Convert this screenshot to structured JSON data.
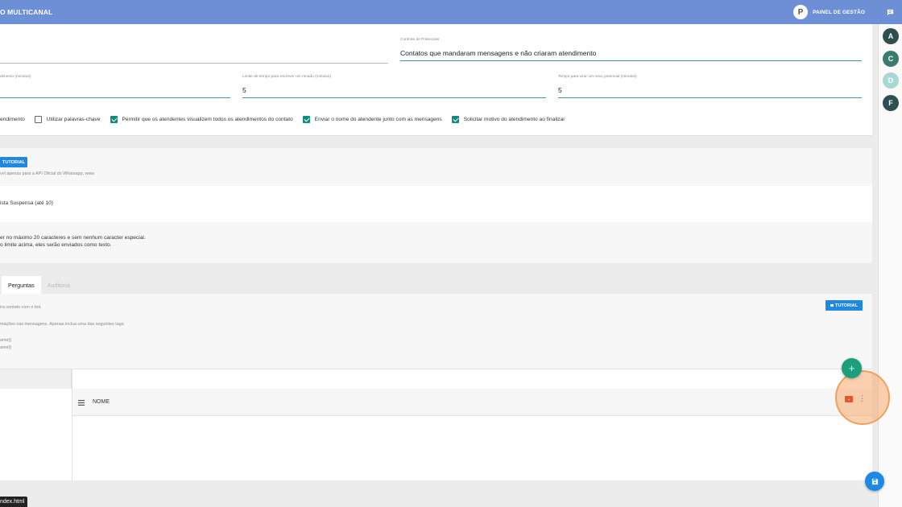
{
  "header": {
    "title": "O MULTICANAL",
    "user_initial": "P",
    "panel_label": "PAINEL DE GESTÃO"
  },
  "rail": {
    "avatars": [
      {
        "initial": "A",
        "color": "#2f4f4f"
      },
      {
        "initial": "C",
        "color": "#3b7a6e"
      },
      {
        "initial": "D",
        "color": "#a8d8d4"
      },
      {
        "initial": "F",
        "color": "#2f4f4f"
      }
    ]
  },
  "settings": {
    "control_label": "Controle de Potenciais",
    "control_value": "Contatos que mandaram mensagens e não criaram atendimento",
    "time_label_1": "dimento (minutos)",
    "time_label_2": "Limite de tempo para escrever um recado (minutos)",
    "time_value_2": "5",
    "time_label_3": "Tempo para virar um novo potencial (minutos)",
    "time_value_3": "5",
    "checks": [
      {
        "label": "endimento",
        "checked": null
      },
      {
        "label": "Utilizar palavras-chave",
        "checked": false
      },
      {
        "label": "Permitir que os atendentes visualizem todos os atendimentos do contato",
        "checked": true
      },
      {
        "label": "Enviar o nome do atendente junto com as mensagens",
        "checked": true
      },
      {
        "label": "Solicitar motivo do atendimento ao finalizar",
        "checked": true
      }
    ]
  },
  "whatsapp": {
    "tutorial_label": "TUTORIAL",
    "note": "vel apenas para a API Oficial do Whatsapp, www",
    "list_label": "ista Suspensa (até 10)",
    "rule_line1": "er no máximo 20 caracteres e sem nenhum caracter especial.",
    "rule_line2": "o limite acima, eles serão enviados como texto."
  },
  "tabs": {
    "active": "Perguntas",
    "inactive": "Auditoria"
  },
  "bot": {
    "line1": "ira contato com o bot.",
    "line2": "mações nas mensagens. Apenas inclua uma das seguintes tags:",
    "tag1": "ame}}",
    "tag2": "ame}}",
    "tutorial_label": "TUTORIAL",
    "column_name": "NOME"
  },
  "status_bar": {
    "text": "ndex.html"
  },
  "colors": {
    "topbar": "#6d8fd6",
    "accent_teal": "#0e8c7e",
    "button_blue": "#1e88e5"
  }
}
